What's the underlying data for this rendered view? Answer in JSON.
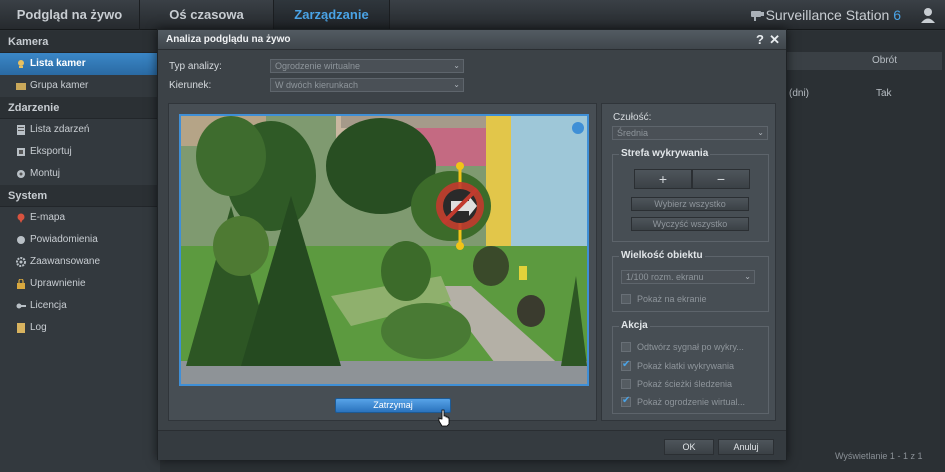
{
  "topbar": {
    "tabs": [
      "Podgląd na żywo",
      "Oś czasowa",
      "Zarządzanie"
    ],
    "brand": "Surveillance Station",
    "brand_version": "6"
  },
  "sidebar": {
    "sections": [
      {
        "title": "Kamera",
        "items": [
          "Lista kamer",
          "Grupa kamer"
        ]
      },
      {
        "title": "Zdarzenie",
        "items": [
          "Lista zdarzeń",
          "Eksportuj",
          "Montuj"
        ]
      },
      {
        "title": "System",
        "items": [
          "E-mapa",
          "Powiadomienia",
          "Zaawansowane",
          "Uprawnienie",
          "Licencja",
          "Log"
        ]
      }
    ],
    "active": "Lista kamer"
  },
  "background": {
    "column_rotate": "Obrót",
    "row_days": "(dni)",
    "row_yes": "Tak",
    "footer": "Wyświetlanie 1 - 1 z 1"
  },
  "dialog": {
    "title": "Analiza podglądu na żywo",
    "help": "?",
    "close": "✕",
    "analysis_type_label": "Typ analizy:",
    "analysis_type_value": "Ogrodzenie wirtualne",
    "direction_label": "Kierunek:",
    "direction_value": "W dwóch kierunkach",
    "stop_button": "Zatrzymaj",
    "sensitivity_label": "Czułość:",
    "sensitivity_value": "Średnia",
    "detection_zone": {
      "title": "Strefa wykrywania",
      "plus": "+",
      "minus": "−",
      "select_all": "Wybierz wszystko",
      "clear_all": "Wyczyść wszystko"
    },
    "object_size": {
      "title": "Wielkość obiektu",
      "value": "1/100 rozm. ekranu",
      "show_on_screen": "Pokaż na ekranie",
      "show_on_screen_checked": false
    },
    "action": {
      "title": "Akcja",
      "items": [
        {
          "label": "Odtwórz sygnał po wykry...",
          "checked": false
        },
        {
          "label": "Pokaż klatki wykrywania",
          "checked": true
        },
        {
          "label": "Pokaż ścieżki śledzenia",
          "checked": false
        },
        {
          "label": "Pokaż ogrodzenie wirtual...",
          "checked": true
        }
      ]
    },
    "ok": "OK",
    "cancel": "Anuluj"
  }
}
